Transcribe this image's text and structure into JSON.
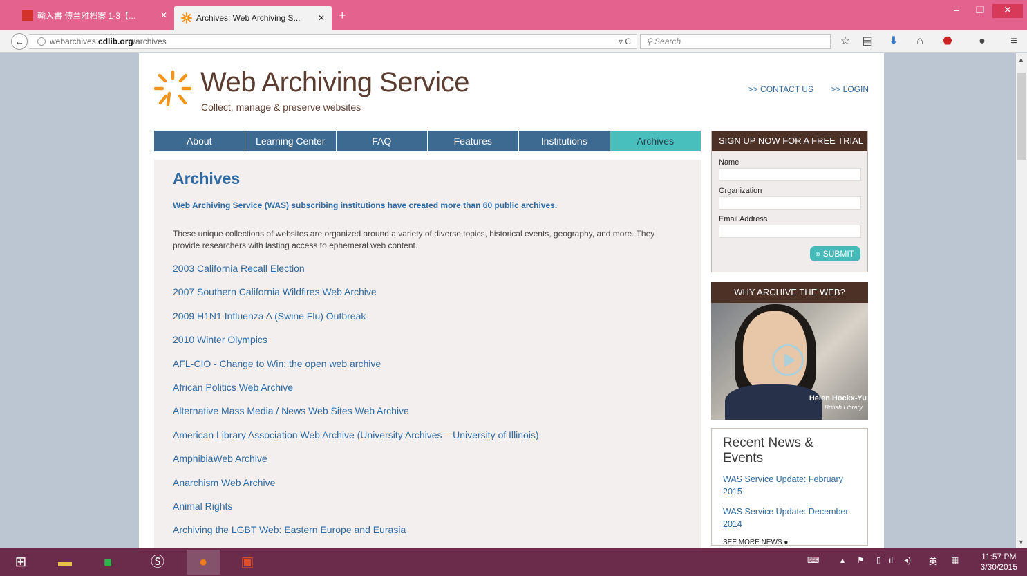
{
  "browser": {
    "tabs": [
      {
        "title": "輸入書 傅兰雅档案 1-3【...",
        "active": false
      },
      {
        "title": "Archives: Web Archiving S...",
        "active": true
      }
    ],
    "new_tab": "+",
    "url_prefix": "webarchives.",
    "url_host": "cdlib.org",
    "url_path": "/archives",
    "search_placeholder": "Search",
    "window": {
      "minimize": "–",
      "restore": "❐",
      "close": "✕"
    }
  },
  "site": {
    "brand": "Web Archiving Service",
    "tagline": "Collect, manage & preserve websites",
    "top_links": [
      ">> CONTACT US",
      ">> LOGIN"
    ],
    "nav": [
      "About",
      "Learning Center",
      "FAQ",
      "Features",
      "Institutions",
      "Archives"
    ],
    "nav_active": "Archives",
    "accent_color": "#48bfbd",
    "nav_color": "#3d6a91",
    "brand_color": "#5a3d30"
  },
  "main": {
    "title": "Archives",
    "intro": "Web Archiving Service (WAS) subscribing institutions have created more than 60 public archives.",
    "description": "These unique collections of websites are organized around a variety of diverse topics, historical events, geography, and more. They provide researchers with lasting access to ephemeral web content.",
    "archives": [
      "2003 California Recall Election",
      "2007 Southern California Wildfires Web Archive",
      "2009 H1N1 Influenza A (Swine Flu) Outbreak",
      "2010 Winter Olympics",
      "AFL-CIO - Change to Win: the open web archive",
      "African Politics Web Archive",
      "Alternative Mass Media / News Web Sites Web Archive",
      "American Library Association Web Archive (University Archives – University of Illinois)",
      "AmphibiaWeb Archive",
      "Anarchism Web Archive",
      "Animal Rights",
      "Archiving the LGBT Web: Eastern Europe and Eurasia"
    ]
  },
  "signup": {
    "heading": "SIGN UP NOW FOR A FREE TRIAL",
    "name_label": "Name",
    "org_label": "Organization",
    "email_label": "Email Address",
    "submit": "» SUBMIT"
  },
  "video": {
    "heading": "WHY ARCHIVE THE WEB?",
    "person": "Helen Hockx-Yu",
    "org": "British Library"
  },
  "news": {
    "heading": "Recent News & Events",
    "items": [
      "WAS Service Update: February 2015",
      "WAS Service Update: December 2014"
    ],
    "more": "SEE MORE NEWS"
  },
  "taskbar": {
    "ime": "英",
    "time": "11:57 PM",
    "date": "3/30/2015"
  }
}
